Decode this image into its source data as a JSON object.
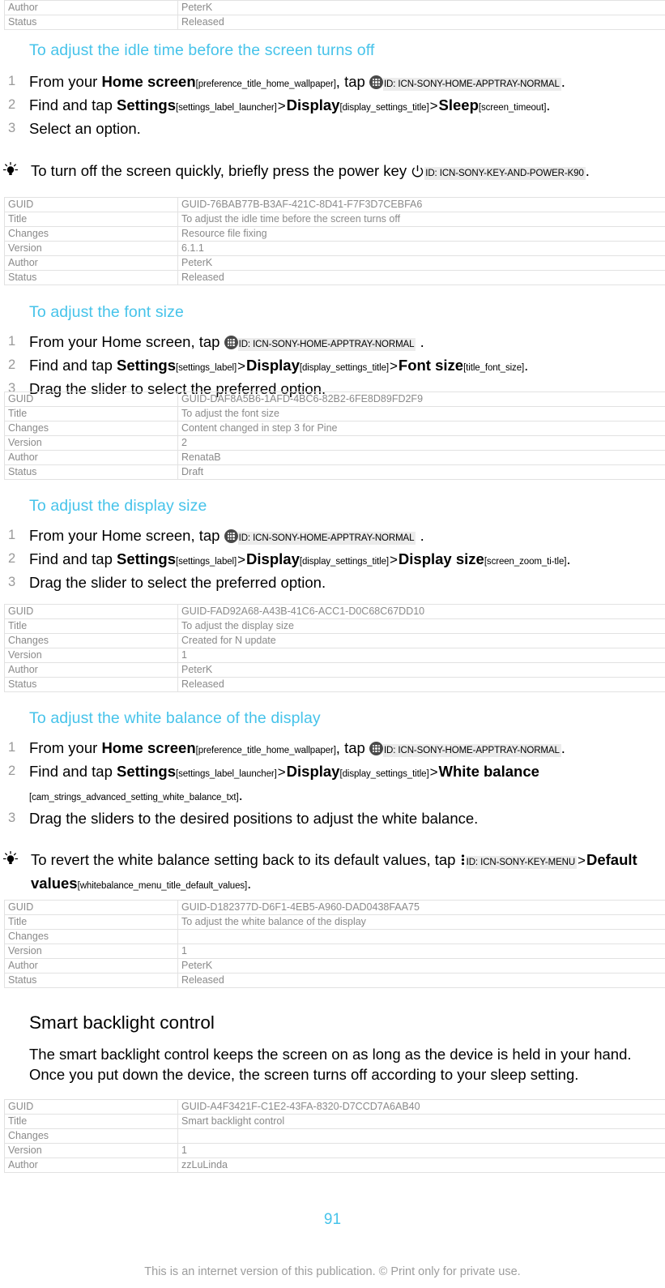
{
  "document": {
    "page_number": "91",
    "copyright": "This is an internet version of this publication. © Print only for private use.",
    "accent_color": "#46c3ea",
    "meta_text_color": "#8a8a8a"
  },
  "top_table": {
    "rows": [
      {
        "key": "Author",
        "value": "PeterK"
      },
      {
        "key": "Status",
        "value": "Released"
      }
    ]
  },
  "sections": [
    {
      "heading": "To adjust the idle time before the screen turns off",
      "steps": [
        {
          "number": "1",
          "parts": {
            "t1": "From your ",
            "b1": "Home screen",
            "r1": "[preference_title_home_wallpaper]",
            "t2": ", tap ",
            "icon": "apptray-icon",
            "chip": "ID: ICN-SONY-HOME-APPTRAY-NORMAL",
            "t3": "."
          }
        },
        {
          "number": "2",
          "parts": {
            "t1": "Find and tap ",
            "b1": "Settings",
            "r1": "[settings_label_launcher]",
            "sep1": ">",
            "b2": "Display",
            "r2": "[display_settings_title]",
            "sep2": ">",
            "b3": "Sleep",
            "r3": "[screen_timeout]",
            "t2": "."
          }
        },
        {
          "number": "3",
          "parts": {
            "t1": "Select an option."
          }
        }
      ],
      "tip": {
        "icon": "lightbulb-icon",
        "t1": "To turn off the screen quickly, briefly press the power key ",
        "icon2": "power-key-icon",
        "chip": "ID: ICN-SONY-KEY-AND-POWER-K90",
        "t2": "."
      },
      "table": [
        {
          "key": "GUID",
          "value": "GUID-76BAB77B-B3AF-421C-8D41-F7F3D7CEBFA6"
        },
        {
          "key": "Title",
          "value": "To adjust the idle time before the screen turns off"
        },
        {
          "key": "Changes",
          "value": "Resource file fixing"
        },
        {
          "key": "Version",
          "value": "6.1.1"
        },
        {
          "key": "Author",
          "value": "PeterK"
        },
        {
          "key": "Status",
          "value": "Released"
        }
      ]
    },
    {
      "heading": "To adjust the font size",
      "steps": [
        {
          "number": "1",
          "parts": {
            "t1": "From your Home screen, tap ",
            "icon": "apptray-icon",
            "chip": "ID: ICN-SONY-HOME-APPTRAY-NORMAL",
            "t3": "."
          }
        },
        {
          "number": "2",
          "parts": {
            "t1": "Find and tap ",
            "b1": "Settings",
            "r1": "[settings_label]",
            "sep1": ">",
            "b2": "Display",
            "r2": "[display_settings_title]",
            "sep2": ">",
            "b3": "Font size",
            "r3": "[title_font_size]",
            "t2": "."
          }
        },
        {
          "number": "3",
          "parts": {
            "t1": "Drag the slider to select the preferred option."
          }
        }
      ],
      "table": [
        {
          "key": "GUID",
          "value": "GUID-DAF8A5B6-1AFD-4BC6-82B2-6FE8D89FD2F9"
        },
        {
          "key": "Title",
          "value": "To adjust the font size"
        },
        {
          "key": "Changes",
          "value": "Content changed in step 3 for Pine"
        },
        {
          "key": "Version",
          "value": "2"
        },
        {
          "key": "Author",
          "value": "RenataB"
        },
        {
          "key": "Status",
          "value": "Draft"
        }
      ]
    },
    {
      "heading": "To adjust the display size",
      "steps": [
        {
          "number": "1",
          "parts": {
            "t1": "From your Home screen, tap ",
            "icon": "apptray-icon",
            "chip": "ID: ICN-SONY-HOME-APPTRAY-NORMAL",
            "t3": "."
          }
        },
        {
          "number": "2",
          "parts": {
            "t1": "Find and tap ",
            "b1": "Settings",
            "r1": "[settings_label]",
            "sep1": ">",
            "b2": "Display",
            "r2": "[display_settings_title]",
            "sep2": ">",
            "b3": "Display size",
            "r3": "[screen_zoom_ti-tle]",
            "t2": "."
          }
        },
        {
          "number": "3",
          "parts": {
            "t1": "Drag the slider to select the preferred option."
          }
        }
      ],
      "table": [
        {
          "key": "GUID",
          "value": "GUID-FAD92A68-A43B-41C6-ACC1-D0C68C67DD10"
        },
        {
          "key": "Title",
          "value": "To adjust the display size"
        },
        {
          "key": "Changes",
          "value": "Created for N update"
        },
        {
          "key": "Version",
          "value": "1"
        },
        {
          "key": "Author",
          "value": "PeterK"
        },
        {
          "key": "Status",
          "value": "Released"
        }
      ]
    },
    {
      "heading": "To adjust the white balance of the display",
      "steps": [
        {
          "number": "1",
          "parts": {
            "t1": "From your ",
            "b1": "Home screen",
            "r1": "[preference_title_home_wallpaper]",
            "t2": ", tap ",
            "icon": "apptray-icon",
            "chip": "ID: ICN-SONY-HOME-APPTRAY-NORMAL",
            "t3": "."
          }
        },
        {
          "number": "2",
          "parts": {
            "t1": "Find and tap ",
            "b1": "Settings",
            "r1": "[settings_label_launcher]",
            "sep1": ">",
            "b2": "Display",
            "r2": "[display_settings_title]",
            "sep2": ">",
            "b3": "White balance",
            "r3": "[cam_strings_advanced_setting_white_balance_txt]",
            "t2": "."
          }
        },
        {
          "number": "3",
          "parts": {
            "t1": "Drag the sliders to the desired positions to adjust the white balance."
          }
        }
      ],
      "tip": {
        "icon": "lightbulb-icon",
        "t1": "To revert the white balance setting back to its default values, tap ",
        "icon2": "menu-key-icon",
        "chip": "ID: ICN-SONY-KEY-MENU",
        "sep": ">",
        "b1": "Default values",
        "r1": "[whitebalance_menu_title_default_values]",
        "t2": "."
      },
      "table": [
        {
          "key": "GUID",
          "value": "GUID-D182377D-D6F1-4EB5-A960-DAD0438FAA75"
        },
        {
          "key": "Title",
          "value": "To adjust the white balance of the display"
        },
        {
          "key": "Changes",
          "value": ""
        },
        {
          "key": "Version",
          "value": "1"
        },
        {
          "key": "Author",
          "value": "PeterK"
        },
        {
          "key": "Status",
          "value": "Released"
        }
      ]
    }
  ],
  "smart_backlight": {
    "heading": "Smart backlight control",
    "paragraph": "The smart backlight control keeps the screen on as long as the device is held in your hand. Once you put down the device, the screen turns off according to your sleep setting.",
    "table": [
      {
        "key": "GUID",
        "value": "GUID-A4F3421F-C1E2-43FA-8320-D7CCD7A6AB40"
      },
      {
        "key": "Title",
        "value": "Smart backlight control"
      },
      {
        "key": "Changes",
        "value": ""
      },
      {
        "key": "Version",
        "value": "1"
      },
      {
        "key": "Author",
        "value": "zzLuLinda"
      }
    ]
  }
}
